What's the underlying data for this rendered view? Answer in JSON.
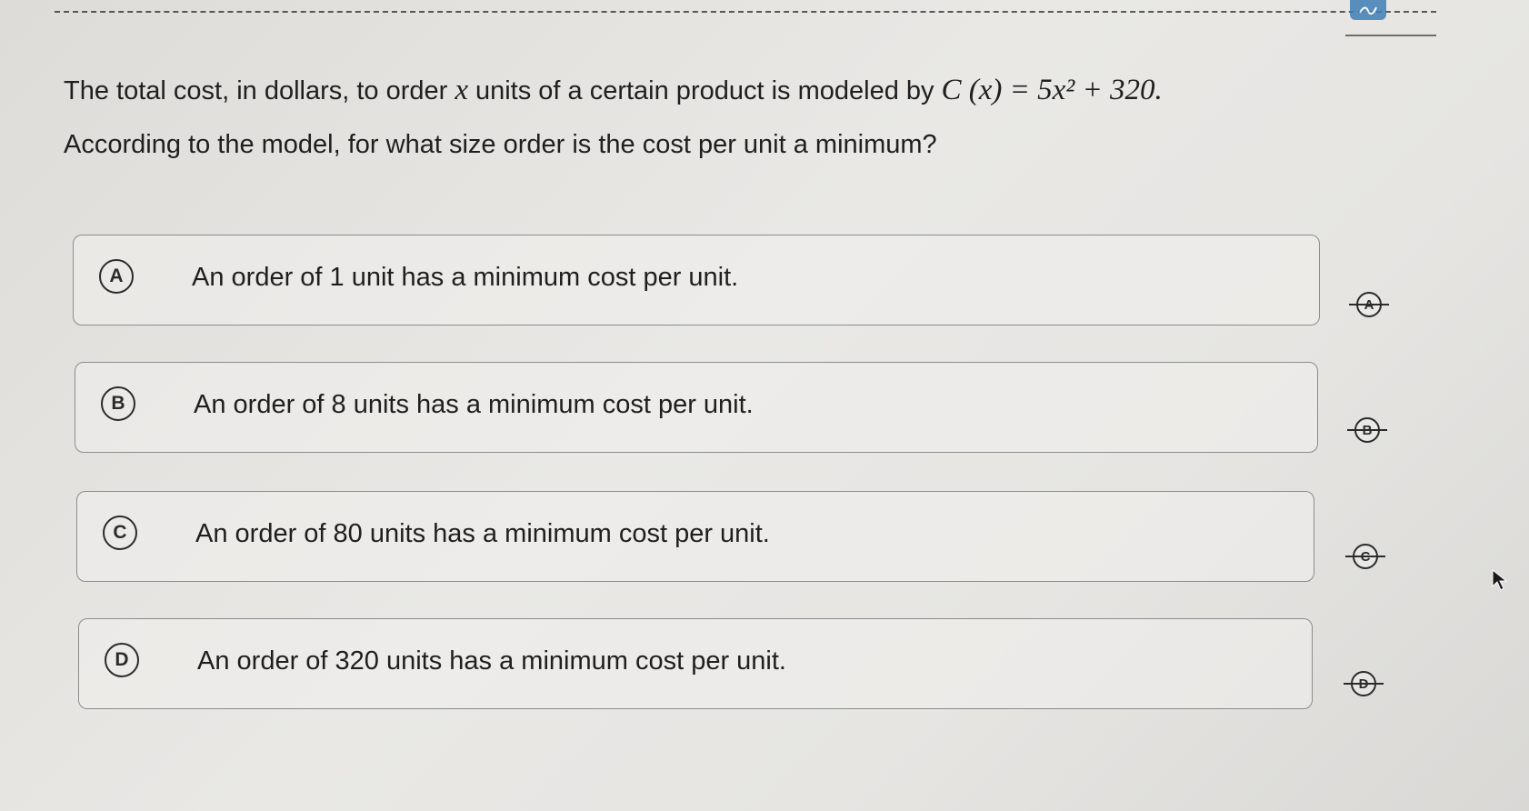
{
  "question": {
    "line1_prefix": "The total cost, in dollars, to order",
    "line1_var": "x",
    "line1_middle": "units of a certain product is modeled by",
    "formula": "C (x) = 5x² + 320.",
    "line2": "According to the model, for what size order is the cost per unit a minimum?"
  },
  "options": [
    {
      "letter": "A",
      "text": "An order of 1 unit has a minimum cost per unit."
    },
    {
      "letter": "B",
      "text": "An order of 8 units has a minimum cost per unit."
    },
    {
      "letter": "C",
      "text": "An order of 80 units has a minimum cost per unit."
    },
    {
      "letter": "D",
      "text": "An order of 320 units has a minimum cost per unit."
    }
  ],
  "icons": {
    "strikethrough": "answer-eliminator-icon",
    "corner_tool": "annotate-tool-icon",
    "cursor": "mouse-pointer-icon"
  },
  "colors": {
    "background": "#e6e5e2",
    "text": "#1f1f1f",
    "border": "#8c8c8c",
    "tool_accent": "#3f7fb6"
  }
}
